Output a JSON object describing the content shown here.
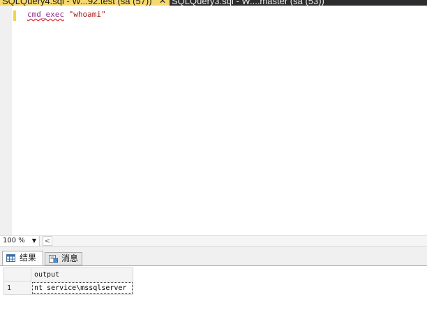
{
  "tabs": [
    {
      "label": "SQLQuery4.sql - W...92.test (sa (57))",
      "close": "✕",
      "active": true
    },
    {
      "label": "SQLQuery3.sql - W....master (sa (53))",
      "active": false
    }
  ],
  "editor": {
    "code_keyword": "cmd_exec",
    "code_string": "\"whoami\""
  },
  "zoom": {
    "value": "100 %"
  },
  "scroll": {
    "left_arrow": "<"
  },
  "result_tabs": [
    {
      "label": "结果",
      "icon": "results-grid-icon",
      "active": true
    },
    {
      "label": "消息",
      "icon": "messages-icon",
      "active": false
    }
  ],
  "grid": {
    "columns": [
      "output"
    ],
    "rows": [
      {
        "num": "1",
        "cells": [
          "nt service\\mssqlserver"
        ]
      }
    ]
  },
  "colors": {
    "active_tab": "#f6d96e",
    "tab_strip": "#2d2d30",
    "change_bar": "#f2d648"
  }
}
